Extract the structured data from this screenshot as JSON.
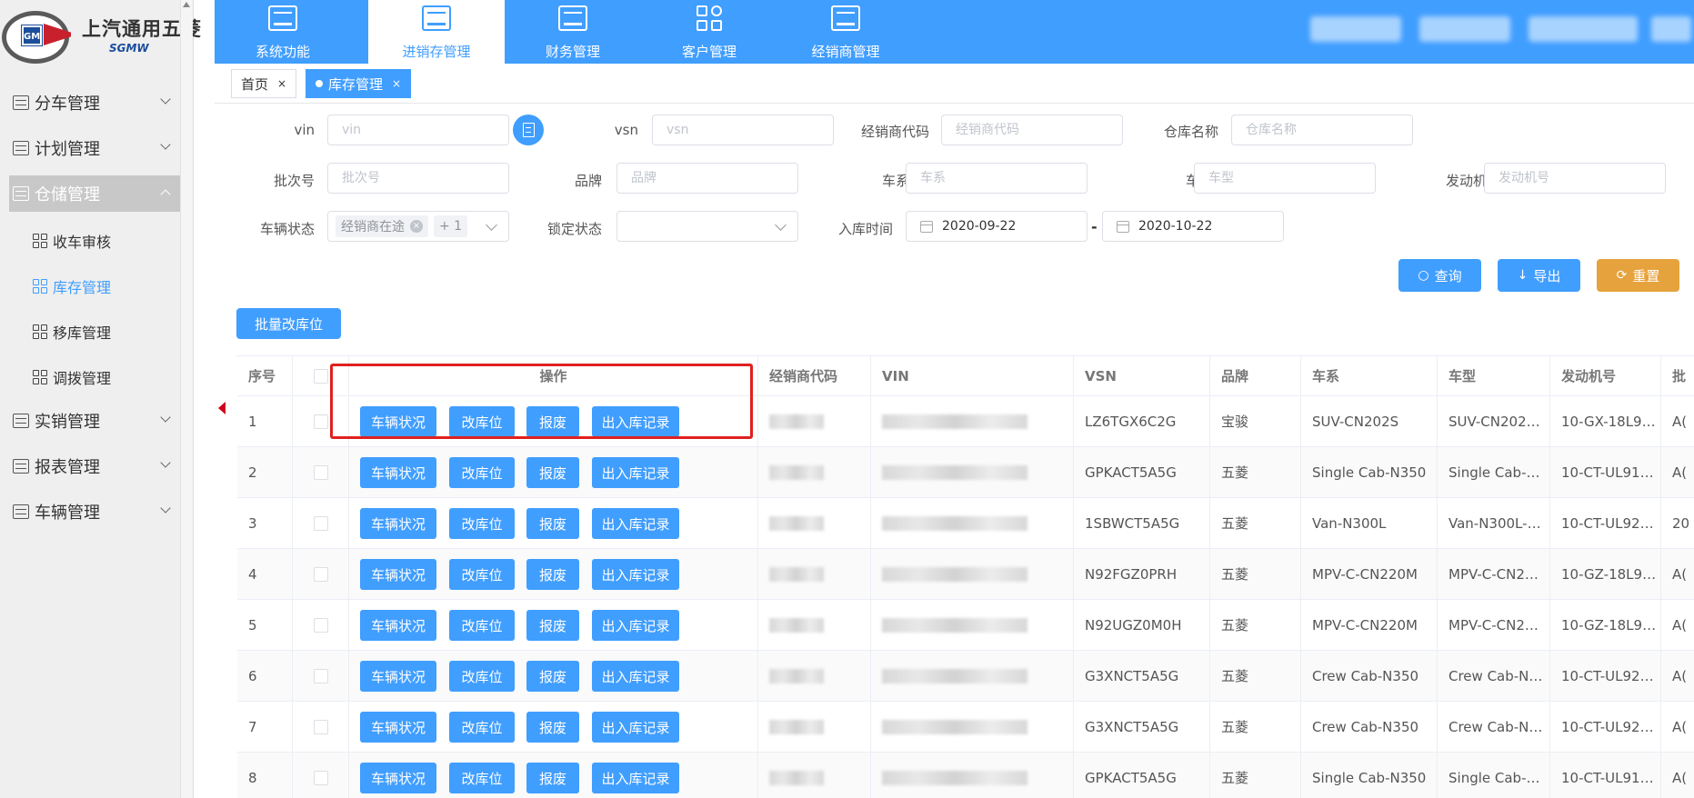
{
  "brand": {
    "name_cn": "上汽通用五菱",
    "name_en": "SGMW",
    "logo_mark": "GM"
  },
  "sidebar": {
    "menus": [
      {
        "label": "分车管理",
        "expanded": false
      },
      {
        "label": "计划管理",
        "expanded": false
      },
      {
        "label": "仓储管理",
        "expanded": true
      },
      {
        "label": "实销管理",
        "expanded": false
      },
      {
        "label": "报表管理",
        "expanded": false
      },
      {
        "label": "车辆管理",
        "expanded": false
      }
    ],
    "submenus": [
      {
        "label": "收车审核",
        "active": false
      },
      {
        "label": "库存管理",
        "active": true
      },
      {
        "label": "移库管理",
        "active": false
      },
      {
        "label": "调拨管理",
        "active": false
      }
    ]
  },
  "topnav": {
    "tabs": [
      {
        "label": "系统功能",
        "active": false
      },
      {
        "label": "进销存管理",
        "active": true
      },
      {
        "label": "财务管理",
        "active": false
      },
      {
        "label": "客户管理",
        "active": false
      },
      {
        "label": "经销商管理",
        "active": false
      }
    ]
  },
  "pagetabs": [
    {
      "label": "首页",
      "active": false,
      "close": "×"
    },
    {
      "label": "库存管理",
      "active": true,
      "close": "×"
    }
  ],
  "filters": {
    "vin": {
      "label": "vin",
      "placeholder": "vin"
    },
    "vsn": {
      "label": "vsn",
      "placeholder": "vsn"
    },
    "dealer_code": {
      "label": "经销商代码",
      "placeholder": "经销商代码"
    },
    "warehouse": {
      "label": "仓库名称",
      "placeholder": "仓库名称"
    },
    "batch": {
      "label": "批次号",
      "placeholder": "批次号"
    },
    "brand": {
      "label": "品牌",
      "placeholder": "品牌"
    },
    "series": {
      "label": "车系",
      "placeholder": "车系"
    },
    "model": {
      "label": "车型",
      "placeholder": "车型"
    },
    "engine": {
      "label": "发动机号",
      "placeholder": "发动机号"
    },
    "vehicle_status": {
      "label": "车辆状态",
      "tag": "经销商在途",
      "more": "+ 1"
    },
    "lock_status": {
      "label": "锁定状态",
      "value": ""
    },
    "inbound_time": {
      "label": "入库时间",
      "start": "2020-09-22",
      "end": "2020-10-22",
      "separator": "-"
    }
  },
  "actions": {
    "query": "查询",
    "export": "导出",
    "reset": "重置",
    "batch_move": "批量改库位"
  },
  "table": {
    "headers": {
      "index": "序号",
      "ops": "操作",
      "dealer_code": "经销商代码",
      "vin": "VIN",
      "vsn": "VSN",
      "brand": "品牌",
      "series": "车系",
      "model": "车型",
      "engine": "发动机号",
      "batch": "批"
    },
    "op_buttons": [
      "车辆状况",
      "改库位",
      "报废",
      "出入库记录"
    ],
    "rows": [
      {
        "index": "1",
        "vsn": "LZ6TGX6C2G",
        "brand": "宝骏",
        "series": "SUV-CN202S",
        "model": "SUV-CN202…",
        "engine": "10-GX-18L9…",
        "batch": "A("
      },
      {
        "index": "2",
        "vsn": "GPKACT5A5G",
        "brand": "五菱",
        "series": "Single Cab-N350",
        "model": "Single Cab-…",
        "engine": "10-CT-UL91…",
        "batch": "A("
      },
      {
        "index": "3",
        "vsn": "1SBWCT5A5G",
        "brand": "五菱",
        "series": "Van-N300L",
        "model": "Van-N300L-…",
        "engine": "10-CT-UL92…",
        "batch": "20"
      },
      {
        "index": "4",
        "vsn": "N92FGZ0PRH",
        "brand": "五菱",
        "series": "MPV-C-CN220M",
        "model": "MPV-C-CN2…",
        "engine": "10-GZ-18L9…",
        "batch": "A("
      },
      {
        "index": "5",
        "vsn": "N92UGZ0M0H",
        "brand": "五菱",
        "series": "MPV-C-CN220M",
        "model": "MPV-C-CN2…",
        "engine": "10-GZ-18L9…",
        "batch": "A("
      },
      {
        "index": "6",
        "vsn": "G3XNCT5A5G",
        "brand": "五菱",
        "series": "Crew Cab-N350",
        "model": "Crew Cab-N…",
        "engine": "10-CT-UL92…",
        "batch": "A("
      },
      {
        "index": "7",
        "vsn": "G3XNCT5A5G",
        "brand": "五菱",
        "series": "Crew Cab-N350",
        "model": "Crew Cab-N…",
        "engine": "10-CT-UL92…",
        "batch": "A("
      },
      {
        "index": "8",
        "vsn": "GPKACT5A5G",
        "brand": "五菱",
        "series": "Single Cab-N350",
        "model": "Single Cab-…",
        "engine": "10-CT-UL91…",
        "batch": "A("
      }
    ]
  },
  "colors": {
    "primary": "#409eff",
    "warning": "#e6a23c",
    "highlight": "#e02020",
    "sidebar_bg": "#efefef"
  }
}
